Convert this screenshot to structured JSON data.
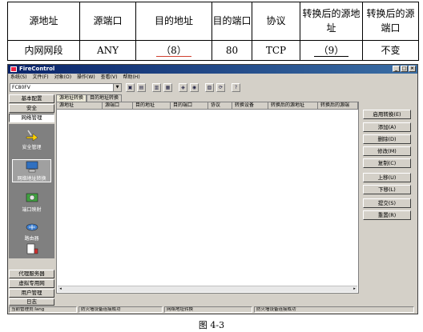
{
  "table": {
    "headers": [
      "源地址",
      "源端口",
      "目的地址",
      "目的端口",
      "协议",
      "转换后的源地址",
      "转换后的源端口"
    ],
    "row": [
      "内网网段",
      "ANY",
      "（8）",
      "80",
      "TCP",
      "（9）",
      "不变"
    ]
  },
  "window": {
    "title": "FireControl",
    "menu": [
      "系统(S)",
      "文件(F)",
      "对象(O)",
      "操作(W)",
      "查看(V)",
      "帮助(H)"
    ],
    "device": "FC80FV",
    "sidebar": {
      "top_buttons": [
        "基本配置",
        "安全",
        "网络管理"
      ],
      "items": [
        "安全管理",
        "网络地址转换",
        "端口映射",
        "路由器"
      ],
      "bottom_buttons": [
        "代理服务器",
        "虚拟专用网",
        "用户管理",
        "日志"
      ]
    },
    "tabs": [
      "源地址转换",
      "目的地址转换"
    ],
    "columns": [
      "源地址",
      "源端口",
      "目的地址",
      "目的端口",
      "协议",
      "转换设备",
      "转换后的源地址",
      "转换后的源端"
    ],
    "actions": [
      "启用转换(E)",
      "添加(A)",
      "删除(D)",
      "修改(M)",
      "复制(C)",
      "上移(U)",
      "下移(L)",
      "提交(S)",
      "重置(R)"
    ],
    "status": [
      "当前管理员:lang",
      "防火墙设备连接成功",
      "网络地址转换",
      "防火墙设备连接成功"
    ]
  },
  "caption": "图 4-3"
}
